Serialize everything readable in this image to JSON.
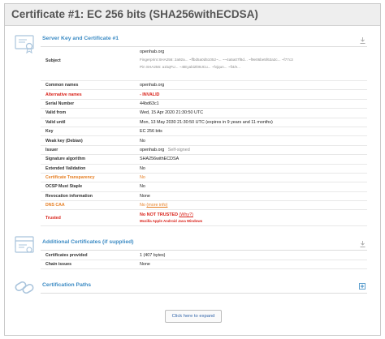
{
  "title": "Certificate #1: EC 256 bits (SHA256withECDSA)",
  "server_key": {
    "heading": "Server Key and Certificate #1",
    "rows": [
      {
        "label": "Subject",
        "lines": [
          "openhab.org",
          "Fingerprint SHA256: 2a92a... ~ffbd5a0d51052~... ~~4a5a07f8d... ~f9e06be5f63a3c... ~f77c3",
          "Pin SHA256: a1kqFU... ~4tEyabi2l09JCu... ~fvjqun... ~fi4/e..."
        ]
      },
      {
        "label": "Common names",
        "value": "openhab.org"
      },
      {
        "label": "Alternative names",
        "value": "-   INVALID"
      },
      {
        "label": "Serial Number",
        "value": "44bd63c1"
      },
      {
        "label": "Valid from",
        "value": "Wed, 15 Apr 2020 21:30:50 UTC"
      },
      {
        "label": "Valid until",
        "value": "Mon, 13 May 2030 21:30:50 UTC (expires in 9 years and 11 months)"
      },
      {
        "label": "Key",
        "value": "EC 256 bits"
      },
      {
        "label": "Weak key (Debian)",
        "value": "No"
      },
      {
        "label": "Issuer",
        "value": "openhab.org",
        "note": "Self-signed"
      },
      {
        "label": "Signature algorithm",
        "value": "SHA256withECDSA"
      },
      {
        "label": "Extended Validation",
        "value": "No"
      },
      {
        "label": "Certificate Transparency",
        "value": "No"
      },
      {
        "label": "OCSP Must Staple",
        "value": "No"
      },
      {
        "label": "Revocation information",
        "value": "None"
      },
      {
        "label": "DNS CAA",
        "value": "No",
        "link": "(more info)"
      },
      {
        "label": "Trusted",
        "value": "No   NOT TRUSTED",
        "link": "(Why?)",
        "clients": "Mozilla  Apple  Android  Java  Windows"
      }
    ]
  },
  "additional": {
    "heading": "Additional Certificates (if supplied)",
    "rows": [
      {
        "label": "Certificates provided",
        "value": "1 (407 bytes)"
      },
      {
        "label": "Chain issues",
        "value": "None"
      }
    ]
  },
  "paths": {
    "heading": "Certification Paths",
    "expand_label": "Click here to expand"
  },
  "colors": {
    "accent": "#3c8bc4",
    "warning": "#e67e22",
    "error": "#d9221a"
  }
}
